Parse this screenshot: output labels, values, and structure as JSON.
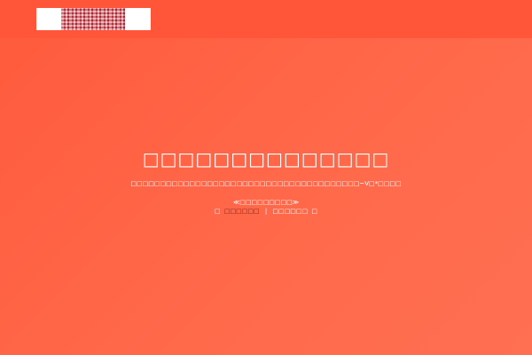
{
  "header": {
    "logo_alt": "Logo"
  },
  "message": {
    "title": "□□□□□□□□□□□□□□",
    "subtitle": "□□□□□□□□□□□□□□□□□□□□□□□□□□□□□□□□□□□□□□□~V□*□□□□",
    "countdown": "≪□□□□□□□□□≫",
    "link_open": "□",
    "link1": "□□□□□□",
    "divider": "|",
    "link2": "□□□□□□",
    "link_close": "□"
  },
  "colors": {
    "background": "#ff5a3c",
    "topbar": "#ff5538",
    "text": "#ffffff",
    "link_dark": "#7a1e12"
  }
}
